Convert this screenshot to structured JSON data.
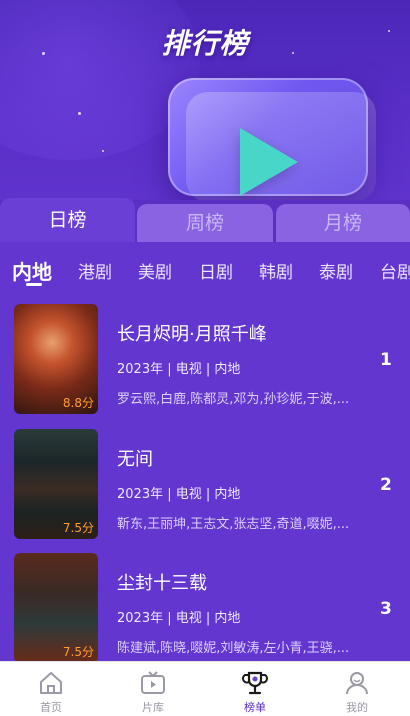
{
  "header": {
    "title": "排行榜"
  },
  "period_tabs": [
    {
      "label": "日榜",
      "active": true
    },
    {
      "label": "周榜",
      "active": false
    },
    {
      "label": "月榜",
      "active": false
    }
  ],
  "categories": [
    {
      "label": "内地",
      "active": true
    },
    {
      "label": "港剧"
    },
    {
      "label": "美剧"
    },
    {
      "label": "日剧"
    },
    {
      "label": "韩剧"
    },
    {
      "label": "泰剧"
    },
    {
      "label": "台剧"
    }
  ],
  "items": [
    {
      "title": "长月烬明·月照千峰",
      "meta": "2023年 | 电视 | 内地",
      "cast": "罗云熙,白鹿,陈都灵,邓为,孙珍妮,于波,...",
      "score": "8.8分",
      "rank": "1"
    },
    {
      "title": "无间",
      "meta": "2023年 | 电视 | 内地",
      "cast": "靳东,王丽坤,王志文,张志坚,奇道,啜妮,...",
      "score": "7.5分",
      "rank": "2"
    },
    {
      "title": "尘封十三载",
      "meta": "2023年 | 电视 | 内地",
      "cast": "陈建斌,陈晓,啜妮,刘敏涛,左小青,王骁,...",
      "score": "7.5分",
      "rank": "3"
    }
  ],
  "bottom_nav": [
    {
      "label": "首页",
      "icon": "home-icon"
    },
    {
      "label": "片库",
      "icon": "tv-icon"
    },
    {
      "label": "榜单",
      "icon": "trophy-icon",
      "active": true
    },
    {
      "label": "我的",
      "icon": "user-icon"
    }
  ],
  "colors": {
    "accent": "#5a2fc2",
    "score": "#ff9d2e",
    "play": "#47d6c8"
  }
}
